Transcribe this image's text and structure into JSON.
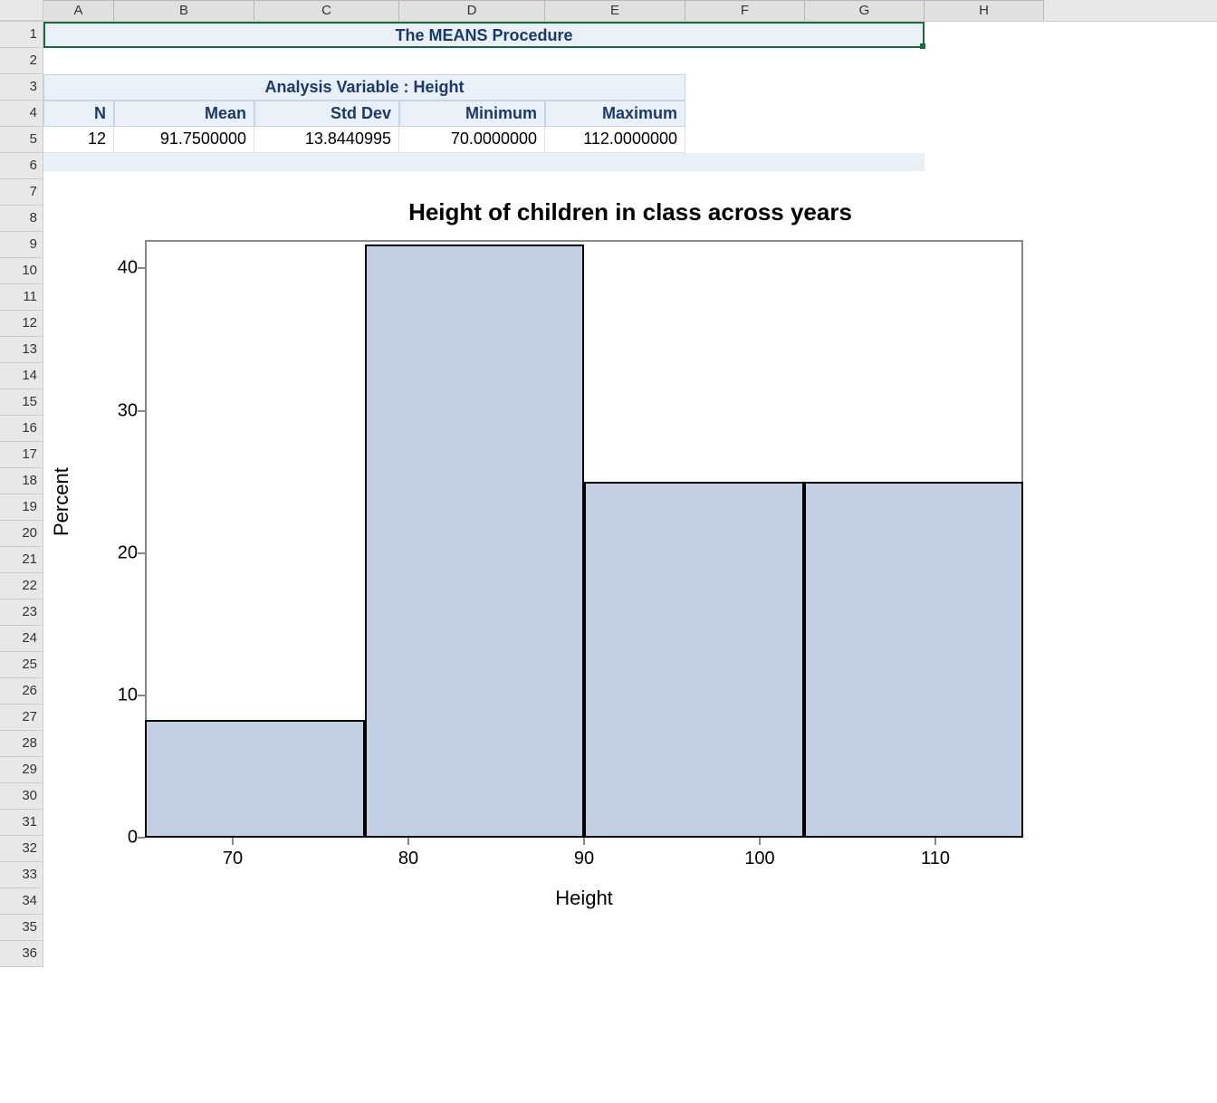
{
  "columns": [
    "A",
    "B",
    "C",
    "D",
    "E",
    "F",
    "G",
    "H"
  ],
  "rows_visible": 36,
  "title": "The MEANS Procedure",
  "analysis_header": "Analysis Variable : Height",
  "stats": {
    "headers": [
      "N",
      "Mean",
      "Std Dev",
      "Minimum",
      "Maximum"
    ],
    "values": [
      "12",
      "91.7500000",
      "13.8440995",
      "70.0000000",
      "112.0000000"
    ]
  },
  "chart_data": {
    "type": "bar",
    "title": "Height of children in class across years",
    "xlabel": "Height",
    "ylabel": "Percent",
    "y_ticks": [
      0,
      10,
      20,
      30,
      40
    ],
    "x_ticks": [
      70,
      80,
      90,
      100,
      110
    ],
    "xlim": [
      65,
      115
    ],
    "ylim": [
      0,
      42
    ],
    "bars": [
      {
        "x_start": 65,
        "x_end": 77.5,
        "value": 8.3
      },
      {
        "x_start": 77.5,
        "x_end": 90,
        "value": 41.7
      },
      {
        "x_start": 90,
        "x_end": 102.5,
        "value": 25.0
      },
      {
        "x_start": 102.5,
        "x_end": 115,
        "value": 25.0
      }
    ]
  },
  "colors": {
    "bar_fill": "#c3d0e3",
    "bar_border": "#000000",
    "header_bg": "#eaf0f8",
    "header_text": "#1a3a6b",
    "selection_border": "#1a6b3a"
  }
}
